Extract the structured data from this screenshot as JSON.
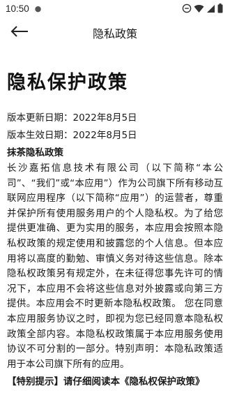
{
  "status_bar": {
    "time": "10:50",
    "notification_indicator": "●",
    "icons": [
      "minus-circle-icon",
      "wifi-icon",
      "signal-icon",
      "battery-icon"
    ]
  },
  "app_bar": {
    "back_icon": "arrow-left-icon",
    "title": "隐私政策"
  },
  "document": {
    "title": "隐私保护政策",
    "update_date": "版本更新日期：2022年8月5日",
    "effective_date": "版本生效日期：2022年8月5日",
    "section_heading": "抹茶隐私政策",
    "body": "长沙嘉拓信息技术有限公司（以下简称“本公司”、“我们”或“本应用”）作为公司旗下所有移动互联网应用程序（以下简称“应用”）的运营者，尊重并保护所有使用服务用户的个人隐私权。为了给您提供更准确、更为实用的服务，本应用会按照本隐私权政策的规定使用和披露您的个人信息。但本应用将以高度的勤勉、审慎义务对待这些信息。除本隐私权政策另有规定外，在未征得您事先许可的情况下，本应用不会将这些信息对外披露或向第三方提供。本应用会不时更新本隐私权政策。 您在同意本应用服务协议之时，即视为您已经同意本隐私权政策全部内容。本隐私权政策属于本应用服务使用协议不可分割的一部分。特别声明：本隐私政策适用于本公司旗下所有的应用。",
    "notice": "【特别提示】请仔细阅读本《隐私权保护政策》"
  }
}
